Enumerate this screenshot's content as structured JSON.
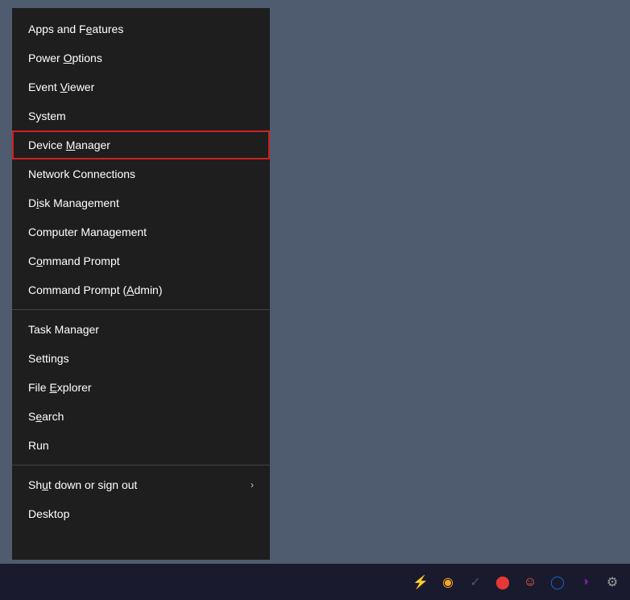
{
  "desktop": {
    "background_color": "#4f5b6e"
  },
  "context_menu": {
    "items": [
      {
        "id": "apps-features",
        "label": "Apps and Features",
        "underline_index": 9,
        "underline_char": "F",
        "has_submenu": false,
        "divider_after": false,
        "highlighted": false
      },
      {
        "id": "power-options",
        "label": "Power Options",
        "underline_index": 6,
        "underline_char": "O",
        "has_submenu": false,
        "divider_after": false,
        "highlighted": false
      },
      {
        "id": "event-viewer",
        "label": "Event Viewer",
        "underline_index": 6,
        "underline_char": "V",
        "has_submenu": false,
        "divider_after": false,
        "highlighted": false
      },
      {
        "id": "system",
        "label": "System",
        "underline_index": -1,
        "underline_char": "",
        "has_submenu": false,
        "divider_after": false,
        "highlighted": false
      },
      {
        "id": "device-manager",
        "label": "Device Manager",
        "underline_index": 7,
        "underline_char": "M",
        "has_submenu": false,
        "divider_after": false,
        "highlighted": true
      },
      {
        "id": "network-connections",
        "label": "Network Connections",
        "underline_index": -1,
        "underline_char": "",
        "has_submenu": false,
        "divider_after": false,
        "highlighted": false
      },
      {
        "id": "disk-management",
        "label": "Disk Management",
        "underline_index": 1,
        "underline_char": "i",
        "has_submenu": false,
        "divider_after": false,
        "highlighted": false
      },
      {
        "id": "computer-management",
        "label": "Computer Management",
        "underline_index": -1,
        "underline_char": "",
        "has_submenu": false,
        "divider_after": false,
        "highlighted": false
      },
      {
        "id": "command-prompt",
        "label": "Command Prompt",
        "underline_index": 1,
        "underline_char": "o",
        "has_submenu": false,
        "divider_after": false,
        "highlighted": false
      },
      {
        "id": "command-prompt-admin",
        "label": "Command Prompt (Admin)",
        "underline_index": -1,
        "underline_char": "A",
        "has_submenu": false,
        "divider_after": true,
        "highlighted": false
      },
      {
        "id": "task-manager",
        "label": "Task Manager",
        "underline_index": -1,
        "underline_char": "",
        "has_submenu": false,
        "divider_after": false,
        "highlighted": false
      },
      {
        "id": "settings",
        "label": "Settings",
        "underline_index": -1,
        "underline_char": "",
        "has_submenu": false,
        "divider_after": false,
        "highlighted": false
      },
      {
        "id": "file-explorer",
        "label": "File Explorer",
        "underline_index": -1,
        "underline_char": "E",
        "has_submenu": false,
        "divider_after": false,
        "highlighted": false
      },
      {
        "id": "search",
        "label": "Search",
        "underline_index": 1,
        "underline_char": "e",
        "has_submenu": false,
        "divider_after": false,
        "highlighted": false
      },
      {
        "id": "run",
        "label": "Run",
        "underline_index": -1,
        "underline_char": "",
        "has_submenu": false,
        "divider_after": true,
        "highlighted": false
      },
      {
        "id": "shut-down",
        "label": "Shut down or sign out",
        "underline_index": -1,
        "underline_char": "u",
        "has_submenu": true,
        "divider_after": false,
        "highlighted": false
      },
      {
        "id": "desktop",
        "label": "Desktop",
        "underline_index": -1,
        "underline_char": "",
        "has_submenu": false,
        "divider_after": false,
        "highlighted": false
      }
    ]
  },
  "taskbar": {
    "icons": [
      {
        "id": "icon-1",
        "symbol": "⚡",
        "color": "icon-green",
        "label": "notification-icon-1"
      },
      {
        "id": "icon-2",
        "symbol": "◉",
        "color": "icon-yellow",
        "label": "notification-icon-2"
      },
      {
        "id": "icon-3",
        "symbol": "✓",
        "color": "icon-dark",
        "label": "notification-icon-3"
      },
      {
        "id": "icon-4",
        "symbol": "⬤",
        "color": "icon-red",
        "label": "notification-icon-4"
      },
      {
        "id": "icon-5",
        "symbol": "☺",
        "color": "icon-orange",
        "label": "notification-icon-5"
      },
      {
        "id": "icon-6",
        "symbol": "◯",
        "color": "icon-blue",
        "label": "notification-icon-6"
      },
      {
        "id": "icon-7",
        "symbol": "◑",
        "color": "icon-purple",
        "label": "notification-icon-7"
      },
      {
        "id": "icon-8",
        "symbol": "⚙",
        "color": "icon-gray",
        "label": "settings-icon"
      }
    ]
  }
}
